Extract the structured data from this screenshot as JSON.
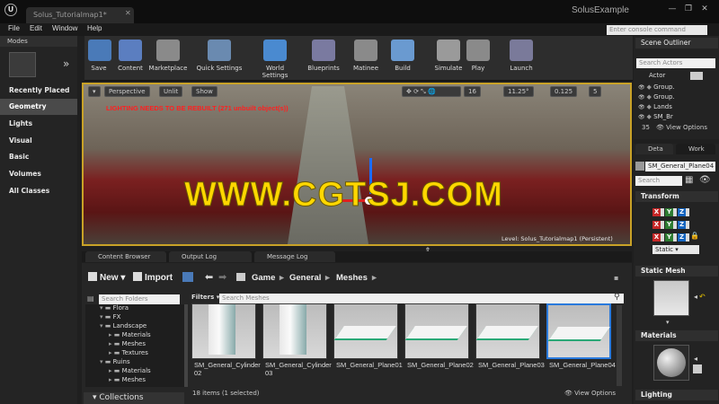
{
  "window": {
    "tab_title": "Solus_Tutorialmap1*",
    "app_name": "SolusExample",
    "logo": "U"
  },
  "menu": [
    "File",
    "Edit",
    "Window",
    "Help"
  ],
  "console": {
    "placeholder": "Enter console command"
  },
  "modes": {
    "header": "Modes",
    "categories": [
      "Recently Placed",
      "Geometry",
      "Lights",
      "Visual",
      "Basic",
      "Volumes",
      "All Classes"
    ],
    "selected": "Geometry"
  },
  "toolbar": [
    {
      "label": "Save",
      "icon": "save-icon",
      "color": "#4a7ab8"
    },
    {
      "label": "Content",
      "icon": "content-icon",
      "color": "#5b7ec0"
    },
    {
      "label": "Marketplace",
      "icon": "marketplace-icon",
      "color": "#8a8a8a"
    },
    {
      "label": "Quick Settings",
      "icon": "settings-icon",
      "color": "#6a8ab0"
    },
    {
      "label": "World Settings",
      "icon": "world-icon",
      "color": "#4a8ad0"
    },
    {
      "label": "Blueprints",
      "icon": "blueprint-icon",
      "color": "#7a7aa0"
    },
    {
      "label": "Matinee",
      "icon": "matinee-icon",
      "color": "#8a8a8a"
    },
    {
      "label": "Build",
      "icon": "build-icon",
      "color": "#6a9ad0"
    },
    {
      "label": "Simulate",
      "icon": "simulate-icon",
      "color": "#9a9a9a"
    },
    {
      "label": "Play",
      "icon": "play-icon",
      "color": "#8a8a8a"
    },
    {
      "label": "Launch",
      "icon": "launch-icon",
      "color": "#7a7a9a"
    }
  ],
  "viewport": {
    "perspective": "Perspective",
    "unlit": "Unlit",
    "show": "Show",
    "grid_snap": "16",
    "rot_snap": "11.25°",
    "scale_snap": "0.125",
    "cam_speed": "5",
    "warning": "LIGHTING NEEDS TO BE REBUILT (271 unbuilt object(s))",
    "watermark": "WWW.CGTSJ.COM",
    "level": "Level:  Solus_Tutorialmap1 (Persistent)"
  },
  "bottom_tabs": [
    "Content Browser",
    "Output Log",
    "Message Log"
  ],
  "content_browser": {
    "new_label": "New",
    "import_label": "Import",
    "path": [
      "Game",
      "General",
      "Meshes"
    ],
    "search_folders": "Search Folders",
    "filters": "Filters",
    "search_assets": "Search Meshes",
    "tree": [
      {
        "label": "Flora",
        "indent": 1
      },
      {
        "label": "FX",
        "indent": 1
      },
      {
        "label": "Landscape",
        "indent": 1
      },
      {
        "label": "Materials",
        "indent": 2
      },
      {
        "label": "Meshes",
        "indent": 2
      },
      {
        "label": "Textures",
        "indent": 2
      },
      {
        "label": "Ruins",
        "indent": 1
      },
      {
        "label": "Materials",
        "indent": 2
      },
      {
        "label": "Meshes",
        "indent": 2
      }
    ],
    "assets": [
      {
        "name": "SM_General_Cylinder02",
        "kind": "cylinder"
      },
      {
        "name": "SM_General_Cylinder03",
        "kind": "cylinder"
      },
      {
        "name": "SM_General_Plane01",
        "kind": "plane"
      },
      {
        "name": "SM_General_Plane02",
        "kind": "plane"
      },
      {
        "name": "SM_General_Plane03",
        "kind": "plane"
      },
      {
        "name": "SM_General_Plane04",
        "kind": "plane",
        "selected": true
      }
    ],
    "status": "18 items (1 selected)",
    "view_options": "View Options",
    "collections": "Collections"
  },
  "outliner": {
    "header": "Scene Outliner",
    "search": "Search Actors",
    "col": "Actor",
    "rows": [
      "Group.",
      "Group.",
      "Lands",
      "SM_Br"
    ],
    "count": "35",
    "view_options": "View Options"
  },
  "details": {
    "tab1": "Deta",
    "tab2": "Work",
    "actor": "SM_General_Plane04",
    "search": "Search",
    "transform": "Transform",
    "mobility": "Static",
    "static_mesh": "Static Mesh",
    "materials": "Materials",
    "lighting": "Lighting"
  }
}
